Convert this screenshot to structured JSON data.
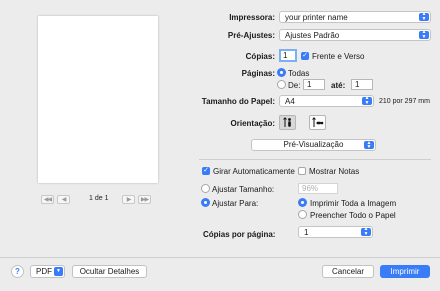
{
  "preview": {
    "page_counter": "1 de 1",
    "first_page_icon": "double-chevron-left-icon",
    "prev_page_icon": "chevron-left-icon",
    "next_page_icon": "chevron-right-icon",
    "last_page_icon": "double-chevron-right-icon"
  },
  "printer": {
    "label": "Impressora:",
    "value": "your printer name"
  },
  "presets": {
    "label": "Pré-Ajustes:",
    "value": "Ajustes Padrão"
  },
  "copies": {
    "label": "Cópias:",
    "value": "1",
    "two_sided_label": "Frente e Verso",
    "two_sided_checked": true
  },
  "pages": {
    "label": "Páginas:",
    "all_label": "Todas",
    "from_label": "De:",
    "from_value": "1",
    "to_label": "até:",
    "to_value": "1",
    "selected": "all"
  },
  "paper_size": {
    "label": "Tamanho do Papel:",
    "value": "A4",
    "dimensions": "210 por 297 mm"
  },
  "orientation": {
    "label": "Orientação:",
    "options": [
      "portrait",
      "landscape"
    ],
    "selected": "portrait"
  },
  "section": {
    "value": "Pré-Visualização"
  },
  "preview_options": {
    "auto_rotate_label": "Girar Automaticamente",
    "auto_rotate_checked": true,
    "show_notes_label": "Mostrar Notas",
    "show_notes_checked": false,
    "scale_label": "Ajustar Tamanho:",
    "scale_value": "96%",
    "fit_label": "Ajustar Para:",
    "fit_selected": true,
    "print_entire_label": "Imprimir Toda a Imagem",
    "fill_paper_label": "Preencher Todo o Papel",
    "fit_mode": "print-entire"
  },
  "copies_per_page": {
    "label": "Cópias por página:",
    "value": "1"
  },
  "footer": {
    "help_label": "?",
    "pdf_label": "PDF",
    "hide_details_label": "Ocultar Detalhes",
    "cancel_label": "Cancelar",
    "print_label": "Imprimir"
  },
  "colors": {
    "accent": "#3a7bf7",
    "background": "#ececec"
  }
}
